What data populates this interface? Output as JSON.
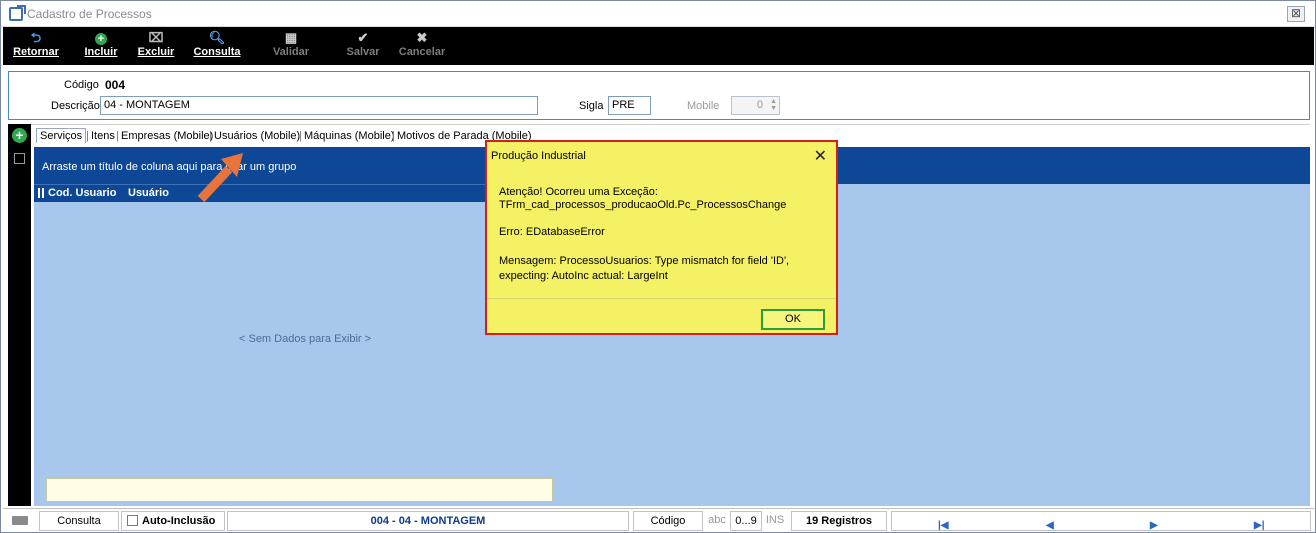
{
  "window": {
    "title": "Cadastro de Processos",
    "close_glyph": "⊠"
  },
  "toolbar": {
    "retornar": "Retornar",
    "incluir": "Incluir",
    "excluir": "Excluir",
    "consulta": "Consulta",
    "validar": "Validar",
    "salvar": "Salvar",
    "cancelar": "Cancelar"
  },
  "form": {
    "codigo_label": "Código",
    "codigo_value": "004",
    "descricao_label": "Descrição",
    "descricao_value": "04 - MONTAGEM",
    "sigla_label": "Sigla",
    "sigla_value": "PRE",
    "mobile_label": "Mobile",
    "mobile_value": "0"
  },
  "tabs": [
    "Serviços",
    "Itens",
    "Empresas (Mobile)",
    "Usuários (Mobile)",
    "Máquinas (Mobile)",
    "Motivos de Parada (Mobile)"
  ],
  "grid": {
    "group_hint": "Arraste um título de coluna aqui para criar um grupo",
    "columns": [
      "Cod. Usuario",
      "Usuário"
    ],
    "empty_text": "< Sem Dados para Exibir >"
  },
  "dialog": {
    "title": "Produção Industrial",
    "line1": "Atenção! Ocorreu uma Exceção:",
    "line2": "TFrm_cad_processos_producaoOld.Pc_ProcessosChange",
    "line3": "Erro: EDatabaseError",
    "line4": " Mensagem: ProcessoUsuarios: Type mismatch for field 'ID',",
    "line5": "expecting: AutoInc actual: LargeInt",
    "ok": "OK"
  },
  "status": {
    "consulta": "Consulta",
    "auto_inclusao": "Auto-Inclusão",
    "record": "004 - 04 - MONTAGEM",
    "codigo": "Código",
    "abc": "abc",
    "range": "0...9",
    "ins": "INS",
    "registros": "19 Registros"
  },
  "colors": {
    "toolbar_bg": "#000000",
    "grid_header": "#0d4795",
    "grid_body": "#a7c7ec",
    "dialog_bg": "#f4f165",
    "dialog_border": "#d11f1f",
    "arrow": "#e8743b"
  }
}
